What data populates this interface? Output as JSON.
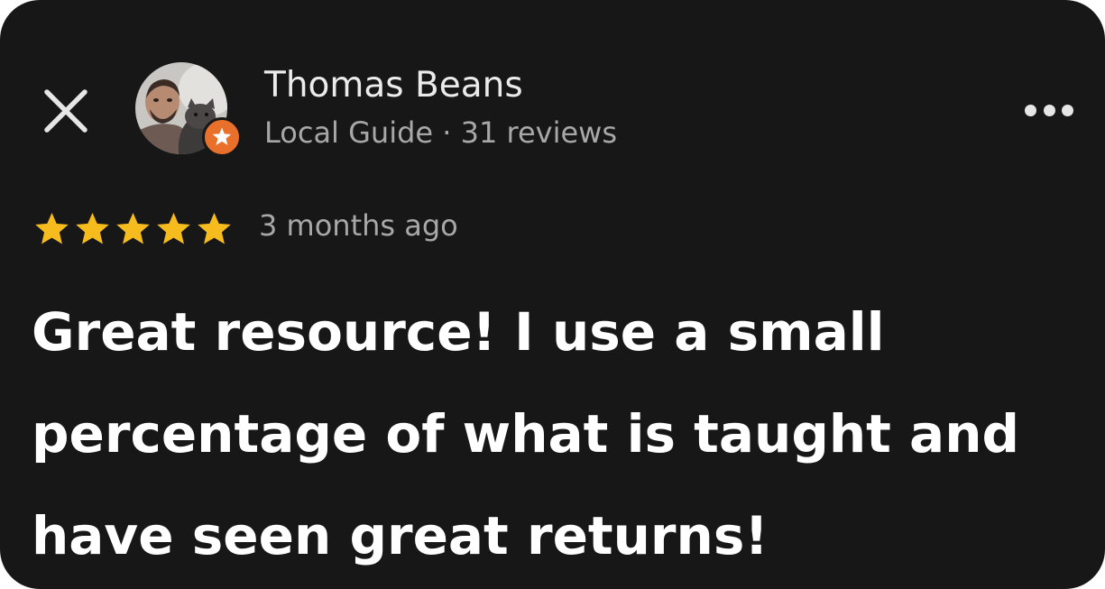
{
  "review": {
    "author_name": "Thomas Beans",
    "author_meta": "Local Guide · 31 reviews",
    "rating": 5,
    "rating_max": 5,
    "date": "3 months ago",
    "text": "Great resource! I use a small percentage of what is taught and have seen great returns!"
  },
  "icons": {
    "close": "close-icon",
    "avatar": "avatar-photo",
    "badge": "local-guide-star-icon",
    "more": "more-horizontal-icon",
    "star": "star-icon"
  },
  "colors": {
    "background": "#171717",
    "star": "#f6bb1d",
    "badge": "#e8702a",
    "primary_text": "#ffffff",
    "secondary_text": "#a8a8a8"
  }
}
